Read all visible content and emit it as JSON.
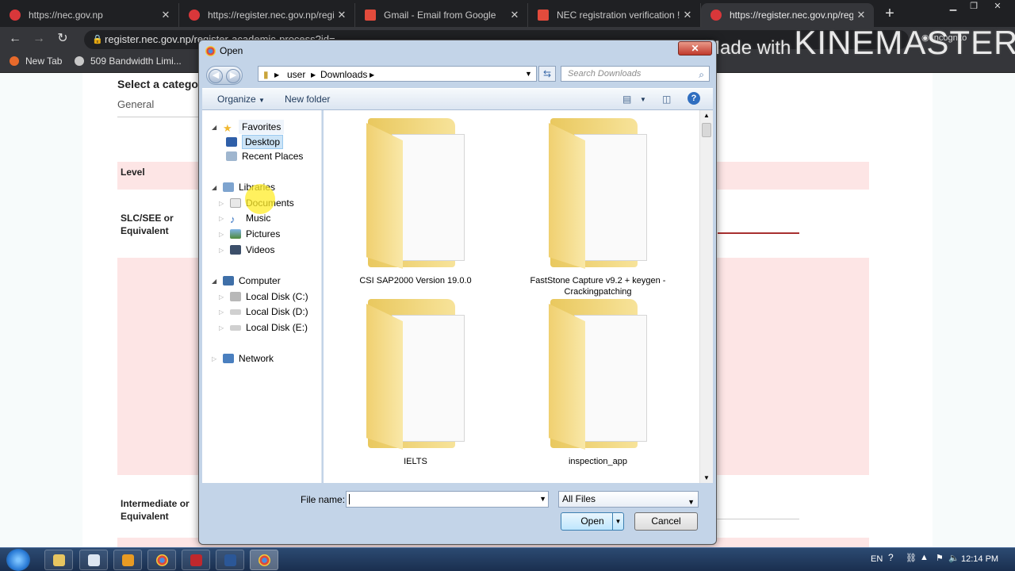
{
  "browser": {
    "tabs": [
      {
        "title": "https://nec.gov.np",
        "active": false
      },
      {
        "title": "https://register.nec.gov.np/regi",
        "active": false
      },
      {
        "title": "Gmail - Email from Google",
        "active": false
      },
      {
        "title": "NEC registration verification ! -",
        "active": false
      },
      {
        "title": "https://register.nec.gov.np/regi",
        "active": true
      }
    ],
    "url": "register.nec.gov.np/register-academic-process?id=...",
    "incognito_label": "Incognito",
    "bookmarks": [
      "New Tab",
      "509 Bandwidth Limi..."
    ]
  },
  "watermark": {
    "prefix": "Made with",
    "brand": "KINEMASTER"
  },
  "page": {
    "select_category": "Select a categor",
    "category_value": "General",
    "level_label": "Level",
    "slc_label_1": "SLC/SEE or",
    "slc_label_2": "Equivalent",
    "intermediate_label_1": "Intermediate or",
    "intermediate_label_2": "Equivalent"
  },
  "dialog": {
    "title": "Open",
    "breadcrumb": [
      "user",
      "Downloads"
    ],
    "search_placeholder": "Search Downloads",
    "organize": "Organize",
    "new_folder": "New folder",
    "nav": {
      "favorites": "Favorites",
      "desktop": "Desktop",
      "recent_places": "Recent Places",
      "libraries": "Libraries",
      "documents": "Documents",
      "music": "Music",
      "pictures": "Pictures",
      "videos": "Videos",
      "computer": "Computer",
      "disk_c": "Local Disk (C:)",
      "disk_d": "Local Disk (D:)",
      "disk_e": "Local Disk (E:)",
      "network": "Network"
    },
    "folders": [
      {
        "line1": "CSI SAP2000 Version 19.0.0",
        "line2": ""
      },
      {
        "line1": "FastStone Capture v9.2 + keygen -",
        "line2": "Crackingpatching"
      },
      {
        "line1": "IELTS",
        "line2": ""
      },
      {
        "line1": "inspection_app",
        "line2": ""
      }
    ],
    "file_name_label": "File name:",
    "file_name_value": "",
    "file_type": "All Files",
    "open_button": "Open",
    "cancel_button": "Cancel"
  },
  "taskbar": {
    "language": "EN",
    "time": "12:14 PM"
  }
}
